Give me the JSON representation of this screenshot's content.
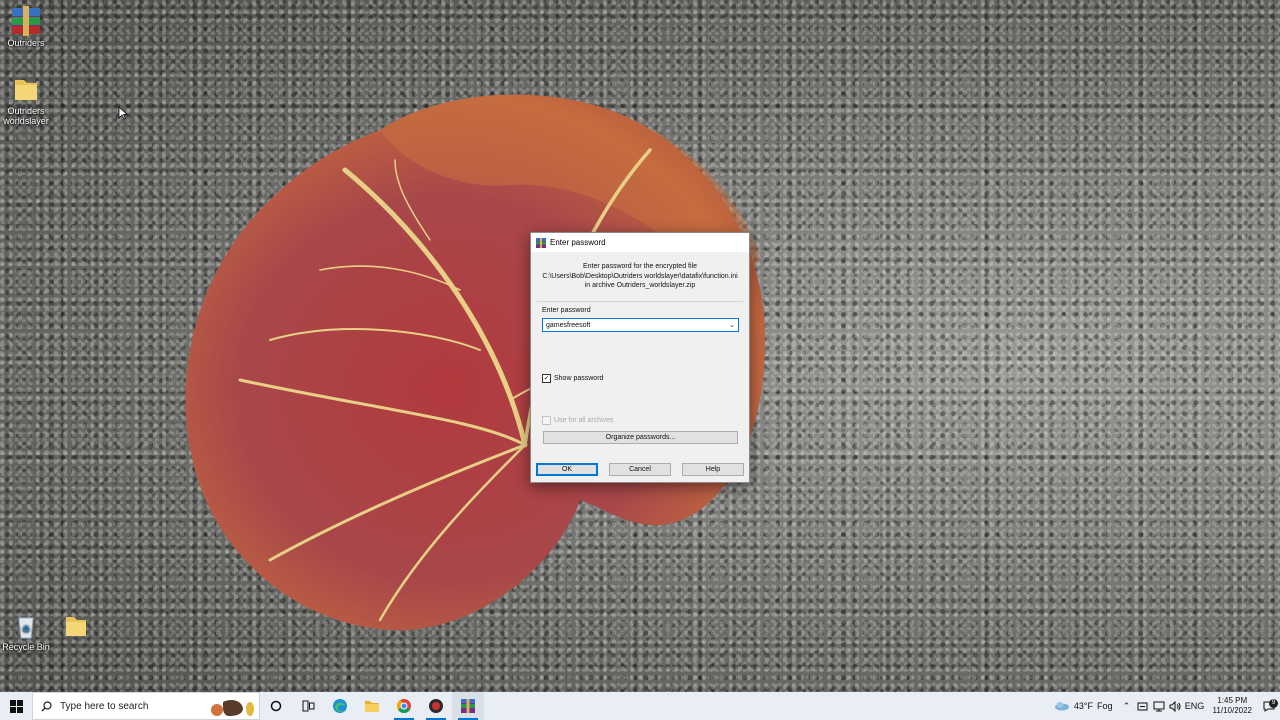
{
  "desktop": {
    "icons": [
      {
        "label": "Outriders",
        "icon": "winrar-archive-icon"
      },
      {
        "label": "Outriders worldslayer",
        "icon": "folder-icon"
      },
      {
        "label": "Recycle Bin",
        "icon": "recycle-bin-icon"
      },
      {
        "label": "",
        "icon": "folder-icon"
      }
    ]
  },
  "dialog": {
    "title": "Enter password",
    "info_line1": "Enter password for the encrypted file",
    "info_line2": "C:\\Users\\Bob\\Desktop\\Outriders worldslayer\\datafix\\function.ini",
    "info_line3": "in archive Outriders_worldslayer.zip",
    "password_label": "Enter password",
    "password_value": "gamesfreesoft",
    "show_password_label": "Show password",
    "show_password_checked": true,
    "use_all_label": "Use for all archives",
    "use_all_checked": false,
    "organize_label": "Organize passwords...",
    "ok_label": "OK",
    "cancel_label": "Cancel",
    "help_label": "Help"
  },
  "taskbar": {
    "search_placeholder": "Type here to search",
    "apps": [
      "task-view-icon",
      "edge-icon",
      "file-explorer-icon",
      "chrome-icon",
      "obs-icon",
      "winrar-icon"
    ],
    "weather_temp": "43°F",
    "weather_desc": "Fog",
    "language": "ENG",
    "time": "1:45 PM",
    "date": "11/10/2022",
    "notification_count": "9"
  },
  "colors": {
    "accent": "#0078d7",
    "taskbar": "#e9eef4",
    "dialog_bg": "#f0f0f0"
  }
}
